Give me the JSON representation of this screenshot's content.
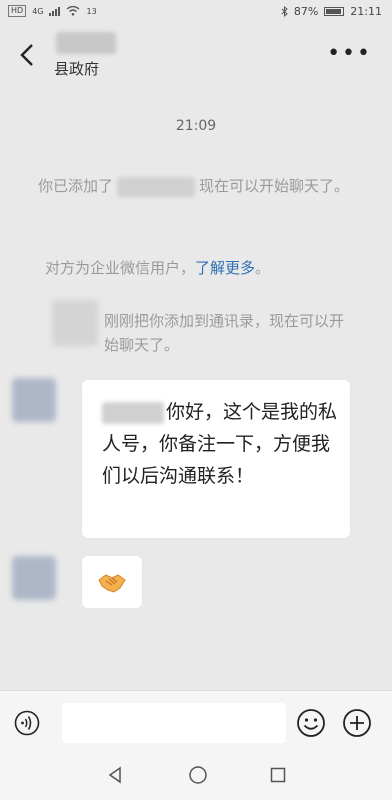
{
  "status_bar": {
    "hd_label": "HD",
    "signal_label": "4G",
    "notif_count": "13",
    "battery": "87%",
    "time": "21:11"
  },
  "header": {
    "title": "县政府",
    "more_icon": "ellipsis-icon",
    "back_icon": "chevron-left-icon"
  },
  "chat": {
    "timestamp": "21:09",
    "system_messages": {
      "added_prefix": "你已添加了",
      "added_suffix": "现在可以开始聊天了。",
      "enterprise_text": "对方为企业微信用户，",
      "enterprise_link": "了解更多",
      "enterprise_end": "。",
      "contact_added": "刚刚把你添加到通讯录，现在可以开始聊天了。"
    },
    "messages": [
      {
        "suffix_text": "你好，这个是我的私人号，你备注一下，方便我们以后沟通联系！"
      },
      {
        "icon": "handshake-icon"
      }
    ]
  },
  "input_bar": {
    "voice_icon": "voice-icon",
    "emoji_icon": "emoji-icon",
    "plus_icon": "plus-icon"
  },
  "nav_bar": {
    "back_icon": "triangle-back-icon",
    "home_icon": "circle-home-icon",
    "recent_icon": "square-recent-icon"
  }
}
